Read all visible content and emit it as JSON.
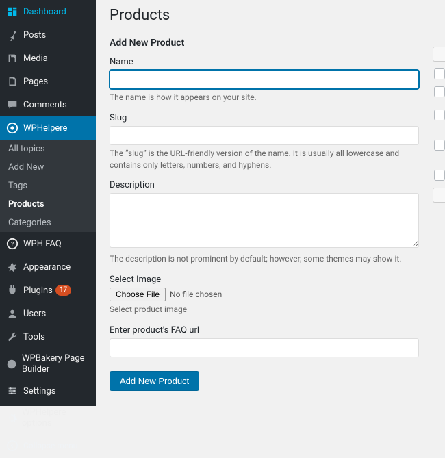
{
  "sidebar": {
    "items": [
      {
        "label": "Dashboard",
        "icon": "dashboard"
      },
      {
        "label": "Posts",
        "icon": "pin"
      },
      {
        "label": "Media",
        "icon": "media"
      },
      {
        "label": "Pages",
        "icon": "pages"
      },
      {
        "label": "Comments",
        "icon": "comments"
      },
      {
        "label": "WPHelpere",
        "icon": "wphelpere",
        "current": true
      },
      {
        "label": "WPH FAQ",
        "icon": "faq"
      },
      {
        "label": "Appearance",
        "icon": "appearance"
      },
      {
        "label": "Plugins",
        "icon": "plugins",
        "badge": "17"
      },
      {
        "label": "Users",
        "icon": "users"
      },
      {
        "label": "Tools",
        "icon": "tools"
      },
      {
        "label": "WPBakery Page Builder",
        "icon": "wpbakery"
      },
      {
        "label": "Settings",
        "icon": "settings"
      },
      {
        "label": "WPHelpere options",
        "icon": "options"
      }
    ],
    "submenu": [
      {
        "label": "All topics"
      },
      {
        "label": "Add New"
      },
      {
        "label": "Tags"
      },
      {
        "label": "Products",
        "current": true
      },
      {
        "label": "Categories"
      }
    ],
    "collapse_label": "Collapse menu"
  },
  "page": {
    "title": "Products",
    "section_title": "Add New Product",
    "name_label": "Name",
    "name_desc": "The name is how it appears on your site.",
    "slug_label": "Slug",
    "slug_desc": "The “slug” is the URL-friendly version of the name. It is usually all lowercase and contains only letters, numbers, and hyphens.",
    "description_label": "Description",
    "description_desc": "The description is not prominent by default; however, some themes may show it.",
    "select_image_label": "Select Image",
    "choose_file_label": "Choose File",
    "no_file_chosen": "No file chosen",
    "select_image_desc": "Select product image",
    "faq_url_label": "Enter product's FAQ url",
    "submit_label": "Add New Product"
  }
}
